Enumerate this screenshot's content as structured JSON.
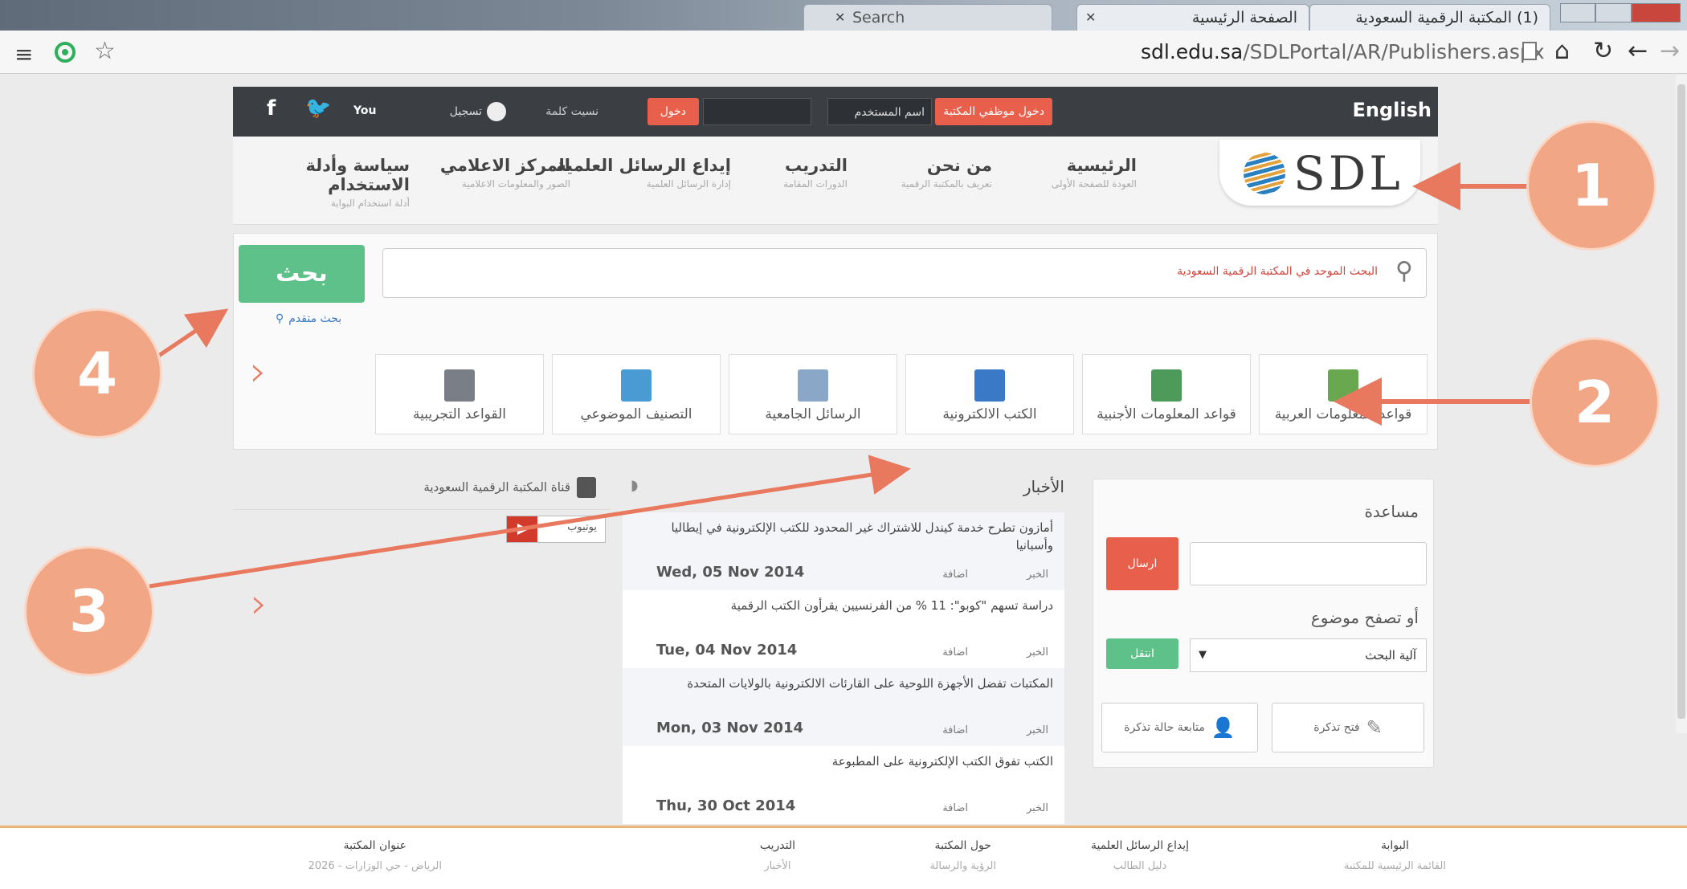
{
  "browser": {
    "tabs": [
      {
        "label": "Search"
      },
      {
        "label": "الصفحة الرئيسية"
      },
      {
        "label": "(1) المكتبة الرقمية السعودية"
      }
    ],
    "url_host": "sdl.edu.sa",
    "url_path": "/SDLPortal/AR/Publishers.aspx",
    "icons": [
      "menu-icon",
      "opera-icon",
      "star-icon",
      "page-icon",
      "home-icon",
      "reload-icon",
      "back-icon",
      "forward-icon"
    ]
  },
  "topbar": {
    "english": "English",
    "staff_login": "دخول موظفي المكتبة",
    "username_placeholder": "اسم المستخدم",
    "login": "دخول",
    "forgot": "نسيت كلمة",
    "register": "تسجيل",
    "social": {
      "facebook": "f",
      "twitter": "t",
      "youtube": "You"
    }
  },
  "logo": {
    "text": "SDL"
  },
  "nav": [
    {
      "title": "الرئيسية",
      "sub": "العودة للصفحة الأولى"
    },
    {
      "title": "من نحن",
      "sub": "تعريف بالمكتبة الرقمية"
    },
    {
      "title": "التدريب",
      "sub": "الدورات المقامة"
    },
    {
      "title": "إيداع الرسائل العلمية",
      "sub": "إدارة الرسائل العلمية"
    },
    {
      "title": "المركز الاعلامي",
      "sub": "الصور والمعلومات الاعلامية"
    },
    {
      "title": "سياسة وأدلة الاستخدام",
      "sub": "أدلة استخدام البوابة"
    }
  ],
  "search": {
    "button": "بحث",
    "placeholder": "البحث الموحد في المكتبة الرقمية السعودية",
    "advanced": "بحث متقدم"
  },
  "databases": [
    {
      "label": "قواعد المعلومات العربية",
      "color": "#6aa84f"
    },
    {
      "label": "قواعد المعلومات الأجنبية",
      "color": "#4e9a5a"
    },
    {
      "label": "الكتب الالكترونية",
      "color": "#3a79c6"
    },
    {
      "label": "الرسائل الجامعية",
      "color": "#8aa7c8"
    },
    {
      "label": "التصنيف الموضوعي",
      "color": "#4a9ad4"
    },
    {
      "label": "القواعد التجريبية",
      "color": "#7a7f87"
    }
  ],
  "help": {
    "title": "مساعدة",
    "send": "ارسال",
    "browse_title": "أو تصفح موضوع",
    "select_value": "آلية البحث",
    "go": "انتقل",
    "open_ticket": "فتح تذكرة",
    "follow_ticket": "متابعة حالة تذكرة"
  },
  "news": {
    "title": "الأخبار",
    "category": "الخبر",
    "added": "اضافة",
    "items": [
      {
        "headline": "أمازون تطرح خدمة كيندل للاشتراك غير المحدود للكتب الإلكترونية في إيطاليا وأسبانيا",
        "date": "Wed, 05 Nov 2014"
      },
      {
        "headline": "دراسة تسهم \"كوبو\": 11 % من الفرنسيين يقرأون الكتب الرقمية",
        "date": "Tue, 04 Nov 2014"
      },
      {
        "headline": "المكتبات تفضل الأجهزة اللوحية على القارئات الالكترونية بالولايات المتحدة",
        "date": "Mon, 03 Nov 2014"
      },
      {
        "headline": "الكتب تفوق الكتب الإلكترونية على المطبوعة",
        "date": "Thu, 30 Oct 2014"
      }
    ]
  },
  "youtube": {
    "title": "قناة المكتبة الرقمية السعودية",
    "subscribe": "يوتيوب"
  },
  "footer": [
    {
      "h": "البوابة",
      "s": "القائمة الرئيسية للمكتبة"
    },
    {
      "h": "إيداع الرسائل العلمية",
      "s": "دليل الطالب"
    },
    {
      "h": "حول المكتبة",
      "s": "الرؤية والرسالة"
    },
    {
      "h": "التدريب",
      "s": "الأخبار"
    },
    {
      "h": "عنوان المكتبة",
      "s": "الرياض - حي الوزارات - 2026"
    }
  ],
  "callouts": [
    "1",
    "2",
    "3",
    "4"
  ],
  "colors": {
    "accent": "#e8604c",
    "green": "#5fc18a",
    "callout": "#f1a685",
    "topbar": "#3b3f44"
  }
}
